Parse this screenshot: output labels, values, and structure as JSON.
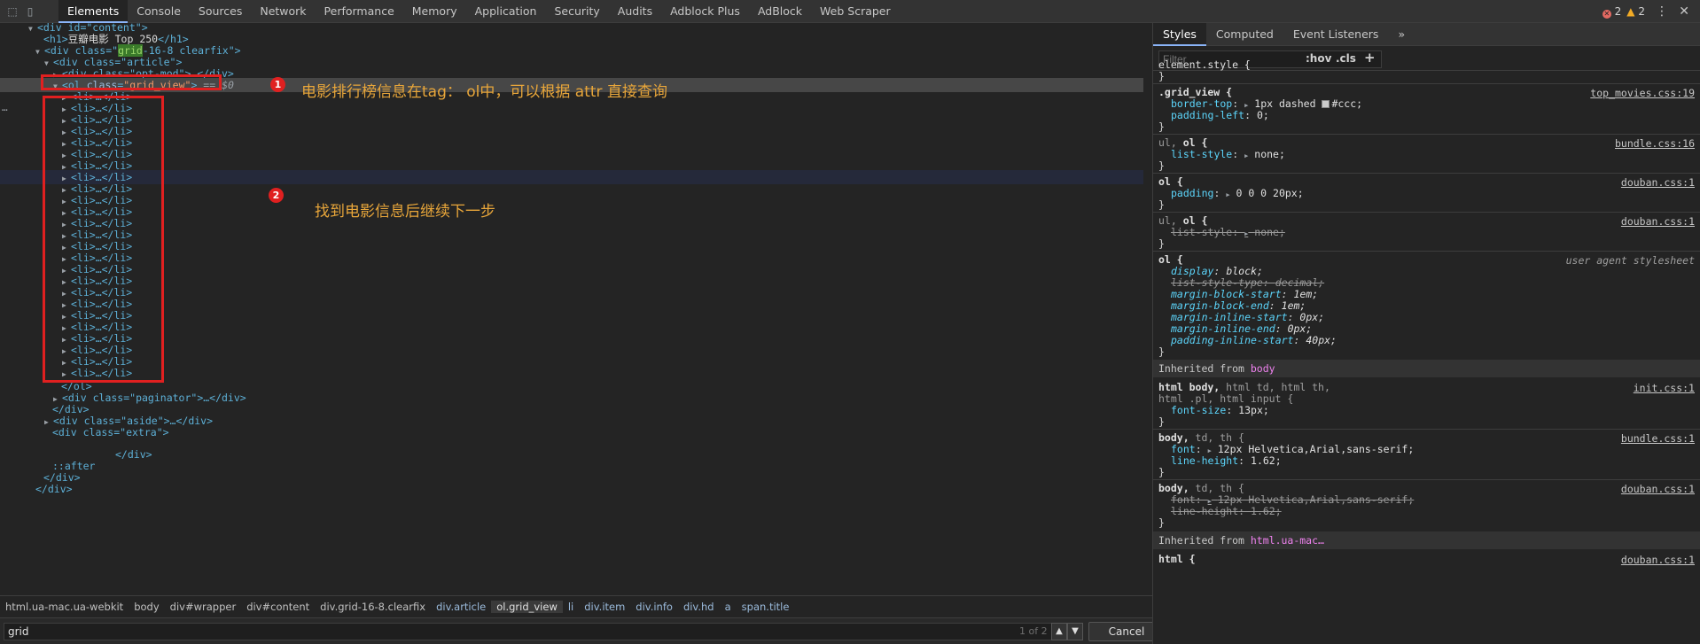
{
  "tabbar": {
    "tabs": [
      "Elements",
      "Console",
      "Sources",
      "Network",
      "Performance",
      "Memory",
      "Application",
      "Security",
      "Audits",
      "Adblock Plus",
      "AdBlock",
      "Web Scraper"
    ],
    "errors": "2",
    "warnings": "2"
  },
  "tree": {
    "content_open": "<div id=\"content\">",
    "h1_tag_open": "<h1>",
    "h1_text": "豆瓣电影 Top 250",
    "h1_tag_close": "</h1>",
    "grid_div_pre": "<div class=\"",
    "grid_div_hl": "grid",
    "grid_div_post": "-16-8 clearfix\">",
    "article_open": "<div class=\"article\">",
    "opt_mod": "<div class=\"opt-mod\">…</div>",
    "ol_open_tag": "<ol ",
    "ol_attr": "class",
    "ol_val": "\"grid_view\"",
    "ol_close_bracket": ">",
    "ol_dollar": " == $0",
    "li_item": "<li>…</li>",
    "ol_close": "</ol>",
    "paginator": "<div class=\"paginator\">…</div>",
    "div_close": "</div>",
    "aside": "<div class=\"aside\">…</div>",
    "extra_open": "<div class=\"extra\">",
    "extra_close": "</div>",
    "after": "::after",
    "div_close_2": "</div>",
    "div_close_3": "</div>",
    "dots": "…"
  },
  "annotations": {
    "badge1": "1",
    "note1": "电影排行榜信息在tag： ol中，可以根据 attr 直接查询",
    "badge2": "2",
    "note2": "找到电影信息后继续下一步"
  },
  "breadcrumbs": [
    "html.ua-mac.ua-webkit",
    "body",
    "div#wrapper",
    "div#content",
    "div.grid-16-8.clearfix",
    "div.article",
    "ol.grid_view",
    "li",
    "div.item",
    "div.info",
    "div.hd",
    "a",
    "span.title"
  ],
  "search": {
    "value": "grid",
    "count": "1 of 2",
    "cancel": "Cancel"
  },
  "styles": {
    "tabs": [
      "Styles",
      "Computed",
      "Event Listeners"
    ],
    "more": "»",
    "filter_placeholder": "Filter",
    "hov": ":hov",
    "cls": ".cls",
    "plus": "+",
    "element_style": "element.style {",
    "close_brace": "}",
    "r1_sel": ".grid_view {",
    "r1_src": "top_movies.css:19",
    "r1_p1": "border-top",
    "r1_v1": "1px dashed",
    "r1_v1c": "#ccc;",
    "r1_p2": "padding-left",
    "r1_v2": "0;",
    "r2_sel_a": "ul,",
    "r2_sel_b": "ol {",
    "r2_src": "bundle.css:16",
    "r2_p1": "list-style",
    "r2_v1": "none;",
    "r3_sel": "ol {",
    "r3_src": "douban.css:1",
    "r3_p1": "padding",
    "r3_v1": "0 0 0 20px;",
    "r4_sel_a": "ul,",
    "r4_sel_b": "ol {",
    "r4_src": "douban.css:1",
    "r4_p1": "list-style",
    "r4_v1": "none;",
    "r5_sel": "ol {",
    "r5_src": "user agent stylesheet",
    "r5_props": [
      {
        "p": "display",
        "v": "block;",
        "strike": false
      },
      {
        "p": "list-style-type",
        "v": "decimal;",
        "strike": true
      },
      {
        "p": "margin-block-start",
        "v": "1em;",
        "strike": false
      },
      {
        "p": "margin-block-end",
        "v": "1em;",
        "strike": false
      },
      {
        "p": "margin-inline-start",
        "v": "0px;",
        "strike": false
      },
      {
        "p": "margin-inline-end",
        "v": "0px;",
        "strike": false
      },
      {
        "p": "padding-inline-start",
        "v": "40px;",
        "strike": false
      }
    ],
    "inherited_label": "Inherited from",
    "inherited_body": "body",
    "r6_sel_a": "html body,",
    "r6_sel_b": " html td, html th,",
    "r6_sel_c": "html .pl, html input {",
    "r6_src": "init.css:1",
    "r6_p1": "font-size",
    "r6_v1": "13px;",
    "r7_sel_a": "body,",
    "r7_sel_b": " td, th {",
    "r7_src": "bundle.css:1",
    "r7_p1": "font",
    "r7_v1": "12px Helvetica,Arial,sans-serif;",
    "r7_p2": "line-height",
    "r7_v2": "1.62;",
    "r8_sel_a": "body,",
    "r8_sel_b": " td, th {",
    "r8_src": "douban.css:1",
    "r8_p1": "font",
    "r8_v1": "12px Helvetica,Arial,sans-serif;",
    "r8_p2": "line-height",
    "r8_v2": "1.62;",
    "inherited_html": "html.ua-mac…",
    "r9_sel": "html {",
    "r9_src": "douban.css:1"
  }
}
